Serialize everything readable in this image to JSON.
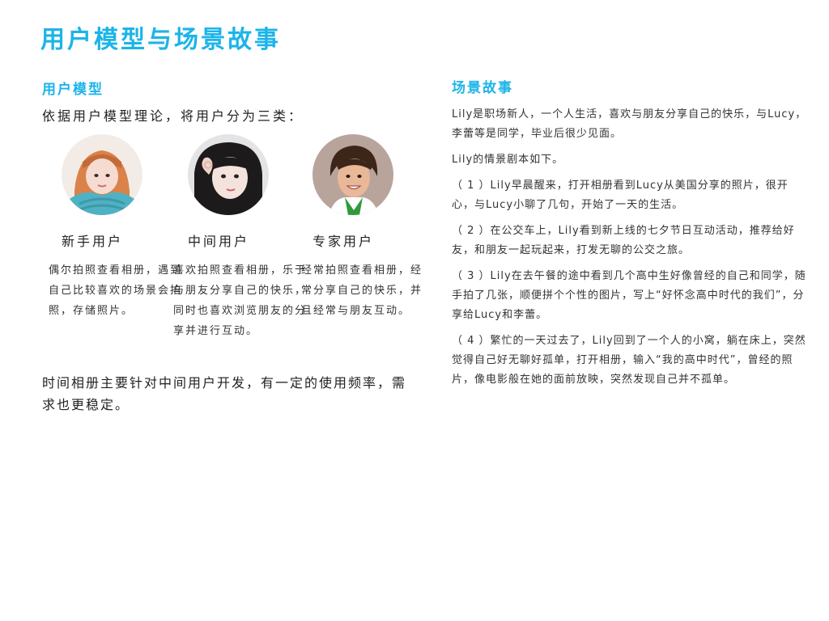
{
  "page_title": "用户模型与场景故事",
  "user_model": {
    "heading": "用户模型",
    "intro": "依据用户模型理论，将用户分为三类：",
    "users": [
      {
        "name": "新手用户",
        "description": "偶尔拍照查看相册，遇到自己比较喜欢的场景会拍照，存储照片。",
        "avatar_icon": "avatar-girl-scarf-icon"
      },
      {
        "name": "中间用户",
        "description": "喜欢拍照查看相册，乐于与朋友分享自己的快乐，同时也喜欢浏览朋友的分享并进行互动。",
        "avatar_icon": "avatar-girl-heart-hand-icon"
      },
      {
        "name": "专家用户",
        "description": "经常拍照查看相册，经常分享自己的快乐，并且经常与朋友互动。",
        "avatar_icon": "avatar-boy-smile-icon"
      }
    ],
    "conclusion": "时间相册主要针对中间用户开发，有一定的使用频率，需求也更稳定。"
  },
  "scenario": {
    "heading": "场景故事",
    "paragraphs": [
      "Lily是职场新人，一个人生活，喜欢与朋友分享自己的快乐，与Lucy，李蕾等是同学，毕业后很少见面。",
      "Lily的情景剧本如下。",
      "（ 1 ）Lily早晨醒来，打开相册看到Lucy从美国分享的照片，很开心，与Lucy小聊了几句，开始了一天的生活。",
      "（ 2 ）在公交车上，Lily看到新上线的七夕节日互动活动，推荐给好友，和朋友一起玩起来，打发无聊的公交之旅。",
      "（ 3 ）Lily在去午餐的途中看到几个高中生好像曾经的自己和同学，随手拍了几张，顺便拼个个性的图片，写上“好怀念高中时代的我们”，分享给Lucy和李蕾。",
      "（ 4 ）繁忙的一天过去了，Lily回到了一个人的小窝，躺在床上，突然觉得自己好无聊好孤单，打开相册，输入“我的高中时代”，曾经的照片，像电影般在她的面前放映，突然发现自己并不孤单。"
    ]
  },
  "colors": {
    "accent": "#1cb4e8",
    "text": "#222222",
    "background": "#ffffff"
  }
}
